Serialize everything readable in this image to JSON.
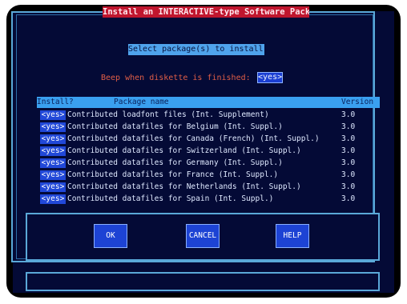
{
  "dialog": {
    "title": "Install an INTERACTIVE-type Software Package",
    "prompt": "Select package(s) to install:",
    "beep_label": "Beep when diskette is finished:",
    "beep_value": "yes"
  },
  "table": {
    "columns": [
      "Install?",
      "Package name",
      "Version"
    ],
    "rows": [
      {
        "install": "yes",
        "name": "Contributed loadfont files (Int. Supplement)",
        "version": "3.0"
      },
      {
        "install": "yes",
        "name": "Contributed datafiles for Belgium (Int. Suppl.)",
        "version": "3.0"
      },
      {
        "install": "yes",
        "name": "Contributed datafiles for Canada (French) (Int. Suppl.)",
        "version": "3.0"
      },
      {
        "install": "yes",
        "name": "Contributed datafiles for Switzerland (Int. Suppl.)",
        "version": "3.0"
      },
      {
        "install": "yes",
        "name": "Contributed datafiles for Germany (Int. Suppl.)",
        "version": "3.0"
      },
      {
        "install": "yes",
        "name": "Contributed datafiles for France (Int. Suppl.)",
        "version": "3.0"
      },
      {
        "install": "yes",
        "name": "Contributed datafiles for Netherlands (Int. Suppl.)",
        "version": "3.0"
      },
      {
        "install": "yes",
        "name": "Contributed datafiles for Spain (Int. Suppl.)",
        "version": "3.0"
      }
    ]
  },
  "buttons": {
    "ok": "OK",
    "cancel": "CANCEL",
    "help": "HELP"
  },
  "colors": {
    "screen_bg": "#040a36",
    "frame": "#5aa8d8",
    "title_bg": "#c0162e",
    "highlight_bg": "#3aa0f0",
    "field_bg": "#1d43d4",
    "beep_text": "#e05e47"
  }
}
